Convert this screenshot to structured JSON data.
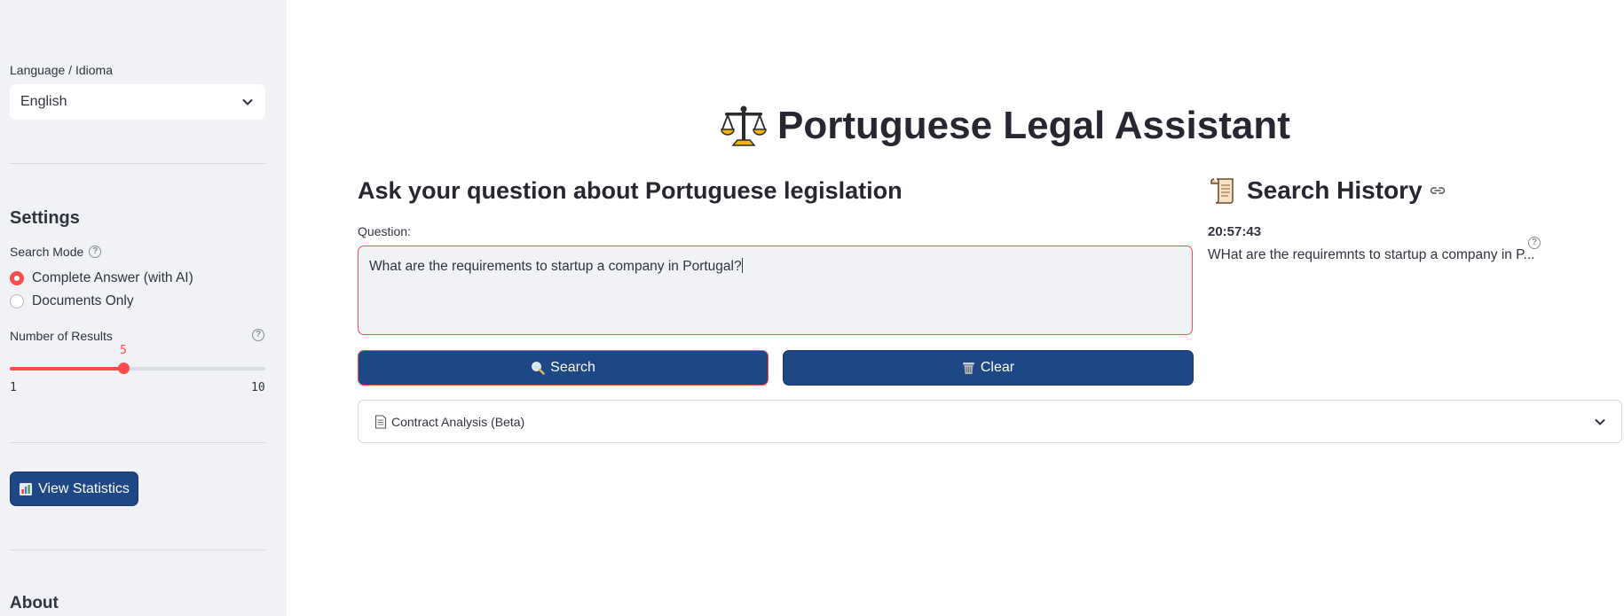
{
  "sidebar": {
    "language_label": "Language / Idioma",
    "language_value": "English",
    "settings_heading": "Settings",
    "search_mode_label": "Search Mode",
    "search_modes": [
      {
        "label": "Complete Answer (with AI)",
        "selected": true
      },
      {
        "label": "Documents Only",
        "selected": false
      }
    ],
    "results_label": "Number of Results",
    "results": {
      "value": 5,
      "min": 1,
      "max": 10,
      "value_text": "5",
      "min_text": "1",
      "max_text": "10"
    },
    "stats_button": "View Statistics",
    "about_heading": "About"
  },
  "main": {
    "title": "Portuguese Legal Assistant",
    "subtitle": "Ask your question about Portuguese legislation",
    "question_label": "Question:",
    "question_value": "What are the requirements to startup a company in Portugal?",
    "search_button": "Search",
    "clear_button": "Clear",
    "expander_label": "Contract Analysis (Beta)"
  },
  "history": {
    "title": "Search History",
    "entries": [
      {
        "time": "20:57:43",
        "query": "WHat are the requiremnts to startup a company in P..."
      }
    ]
  },
  "colors": {
    "accent": "#ff4b4b",
    "button": "#1e4785",
    "sidebar_bg": "#f0f2f6"
  },
  "icons": [
    "chevron-down-icon",
    "help-icon",
    "scales-icon",
    "search-icon",
    "trash-icon",
    "chart-icon",
    "document-icon",
    "scroll-icon",
    "link-icon"
  ]
}
